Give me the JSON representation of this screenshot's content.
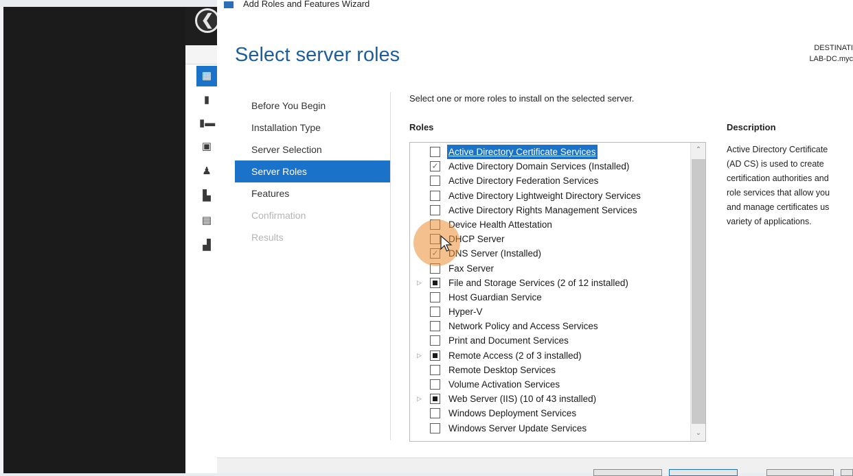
{
  "window": {
    "title": "Add Roles and Features Wizard"
  },
  "server_manager": {
    "back_glyph": "❮"
  },
  "heading": "Select server roles",
  "destination": {
    "label": "DESTINATI",
    "server": "LAB-DC.myc"
  },
  "nav": {
    "items": [
      {
        "label": "Before You Begin",
        "state": "normal"
      },
      {
        "label": "Installation Type",
        "state": "normal"
      },
      {
        "label": "Server Selection",
        "state": "normal"
      },
      {
        "label": "Server Roles",
        "state": "active"
      },
      {
        "label": "Features",
        "state": "normal"
      },
      {
        "label": "Confirmation",
        "state": "disabled"
      },
      {
        "label": "Results",
        "state": "disabled"
      }
    ]
  },
  "instruction": "Select one or more roles to install on the selected server.",
  "roles_header": "Roles",
  "roles": [
    {
      "label": "Active Directory Certificate Services",
      "state": "unchecked",
      "expandable": false,
      "selected": true
    },
    {
      "label": "Active Directory Domain Services (Installed)",
      "state": "checked",
      "expandable": false,
      "selected": false
    },
    {
      "label": "Active Directory Federation Services",
      "state": "unchecked",
      "expandable": false,
      "selected": false
    },
    {
      "label": "Active Directory Lightweight Directory Services",
      "state": "unchecked",
      "expandable": false,
      "selected": false
    },
    {
      "label": "Active Directory Rights Management Services",
      "state": "unchecked",
      "expandable": false,
      "selected": false
    },
    {
      "label": "Device Health Attestation",
      "state": "unchecked",
      "expandable": false,
      "selected": false
    },
    {
      "label": "DHCP Server",
      "state": "unchecked",
      "expandable": false,
      "selected": false
    },
    {
      "label": "DNS Server (Installed)",
      "state": "checked",
      "expandable": false,
      "selected": false
    },
    {
      "label": "Fax Server",
      "state": "unchecked",
      "expandable": false,
      "selected": false
    },
    {
      "label": "File and Storage Services (2 of 12 installed)",
      "state": "partial",
      "expandable": true,
      "selected": false
    },
    {
      "label": "Host Guardian Service",
      "state": "unchecked",
      "expandable": false,
      "selected": false
    },
    {
      "label": "Hyper-V",
      "state": "unchecked",
      "expandable": false,
      "selected": false
    },
    {
      "label": "Network Policy and Access Services",
      "state": "unchecked",
      "expandable": false,
      "selected": false
    },
    {
      "label": "Print and Document Services",
      "state": "unchecked",
      "expandable": false,
      "selected": false
    },
    {
      "label": "Remote Access (2 of 3 installed)",
      "state": "partial",
      "expandable": true,
      "selected": false
    },
    {
      "label": "Remote Desktop Services",
      "state": "unchecked",
      "expandable": false,
      "selected": false
    },
    {
      "label": "Volume Activation Services",
      "state": "unchecked",
      "expandable": false,
      "selected": false
    },
    {
      "label": "Web Server (IIS) (10 of 43 installed)",
      "state": "partial",
      "expandable": true,
      "selected": false
    },
    {
      "label": "Windows Deployment Services",
      "state": "unchecked",
      "expandable": false,
      "selected": false
    },
    {
      "label": "Windows Server Update Services",
      "state": "unchecked",
      "expandable": false,
      "selected": false
    }
  ],
  "description": {
    "header": "Description",
    "text": "Active Directory Certificate\n(AD CS) is used to create\ncertification authorities and\nrole services that allow you\nand manage certificates us\nvariety of applications."
  },
  "glyphs": {
    "check": "✓",
    "expand": "▷",
    "scroll_up": "⌃",
    "scroll_down": "⌄"
  },
  "colors": {
    "accent": "#1b73c9",
    "heading": "#1c5f9c",
    "cursor_halo": "#eb8c32"
  }
}
